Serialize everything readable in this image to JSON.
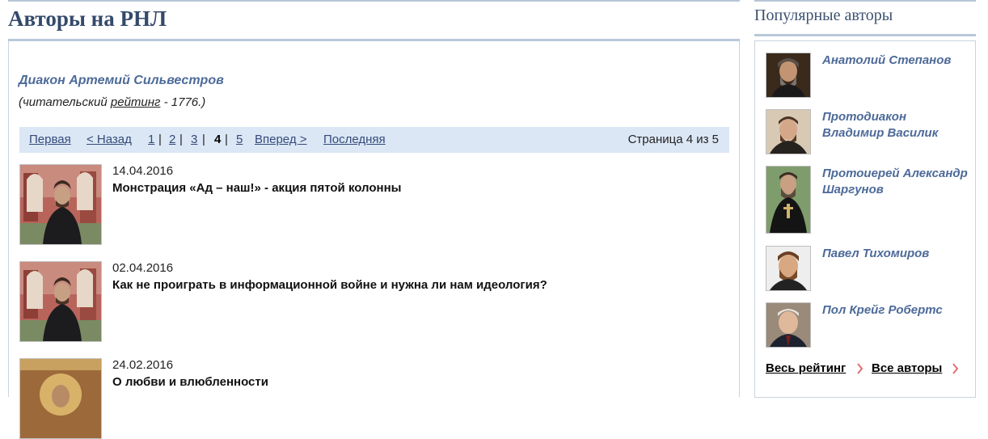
{
  "page": {
    "title": "Авторы на РНЛ"
  },
  "author": {
    "name": "Диакон Артемий Сильвестров",
    "rating_prefix": "(читательский ",
    "rating_link": "рейтинг",
    "rating_suffix": " - 1776.)"
  },
  "pager": {
    "first": "Первая",
    "prev": "< Назад",
    "pages": [
      "1",
      "2",
      "3",
      "4",
      "5"
    ],
    "current": "4",
    "separator": "|",
    "next": "Вперед >",
    "last": "Последняя",
    "info": "Страница 4 из 5"
  },
  "articles": [
    {
      "date": "14.04.2016",
      "title": "Монстрация «Ад – наш!» - акция пятой колонны"
    },
    {
      "date": "02.04.2016",
      "title": "Как не проиграть в информационной войне и нужна ли нам идеология?"
    },
    {
      "date": "24.02.2016",
      "title": "О любви и влюбленности"
    }
  ],
  "sidebar": {
    "title": "Популярные авторы",
    "authors": [
      {
        "name": "Анатолий Степанов"
      },
      {
        "name": "Протодиакон Владимир Василик"
      },
      {
        "name": "Протоиерей Александр Шаргунов"
      },
      {
        "name": "Павел Тихомиров"
      },
      {
        "name": "Пол Крейг Робертс"
      }
    ],
    "rating_link": "Весь рейтинг",
    "all_link": "Все авторы"
  },
  "colors": {
    "heading": "#344a6b",
    "link_blue": "#4d6a99",
    "pager_bg": "#dce7f5",
    "chevron": "#e07070"
  }
}
